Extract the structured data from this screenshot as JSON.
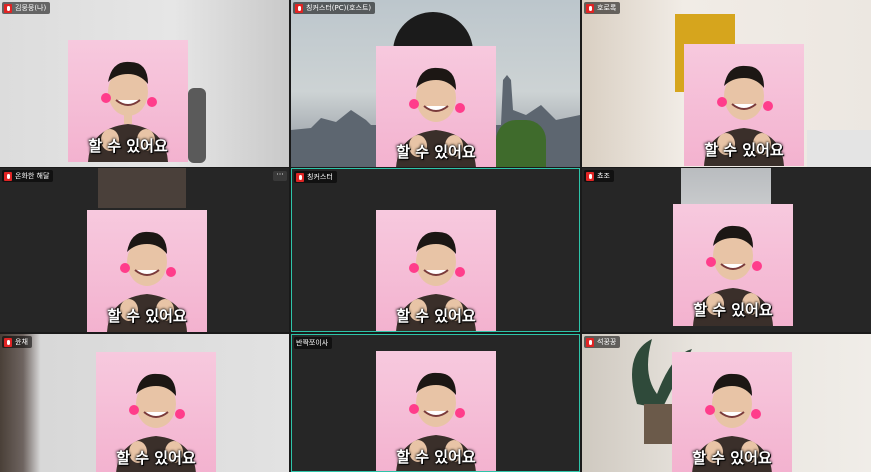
{
  "participants": [
    {
      "name": "김뭉뭉(나)",
      "caption": "할 수 있어요",
      "active": false
    },
    {
      "name": "칭커스터(PC)(호스트)",
      "caption": "할 수 있어요",
      "active": false
    },
    {
      "name": "호로록",
      "caption": "할 수 있어요",
      "active": false
    },
    {
      "name": "온화한 해달",
      "caption": "할 수 있어요",
      "active": false
    },
    {
      "name": "칭커스터",
      "caption": "할 수 있어요",
      "active": true
    },
    {
      "name": "쵸조",
      "caption": "할 수 있어요",
      "active": false
    },
    {
      "name": "윤채",
      "caption": "할 수 있어요",
      "active": false
    },
    {
      "name": "반짝쪼이사",
      "caption": "할 수 있어요",
      "active": true
    },
    {
      "name": "석꿍꿍",
      "caption": "할 수 있어요",
      "active": false
    }
  ],
  "more_label": "···",
  "colors": {
    "active_border": "#2ec4a9",
    "mic_muted": "#e02424"
  }
}
